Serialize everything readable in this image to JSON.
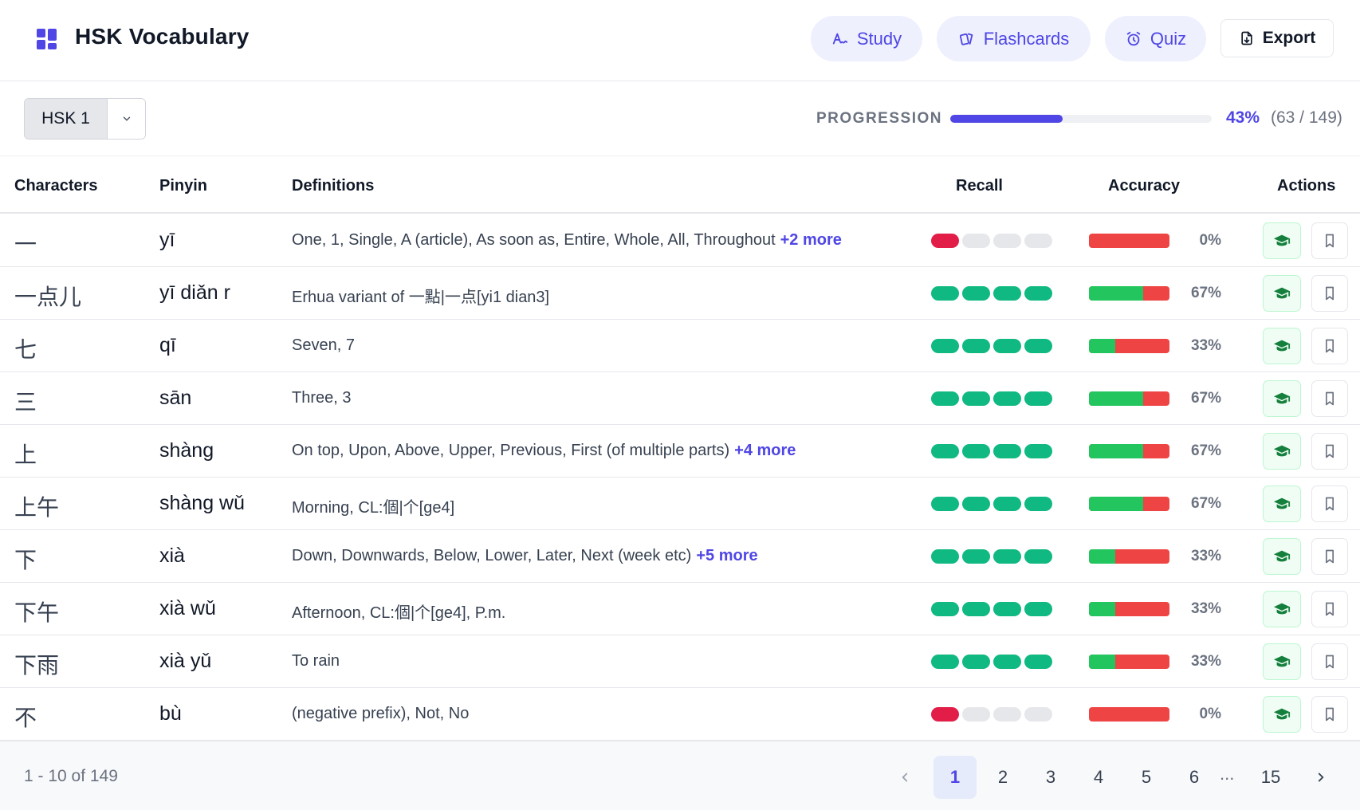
{
  "header": {
    "title": "HSK Vocabulary",
    "nav": {
      "study": "Study",
      "flashcards": "Flashcards",
      "quiz": "Quiz",
      "export": "Export"
    }
  },
  "toolbar": {
    "level": "HSK 1",
    "progress_label": "PROGRESSION",
    "progress_pct": "43%",
    "progress_count": "(63 / 149)",
    "progress_fraction": 0.43
  },
  "table": {
    "headers": {
      "characters": "Characters",
      "pinyin": "Pinyin",
      "definitions": "Definitions",
      "recall": "Recall",
      "accuracy": "Accuracy",
      "actions": "Actions"
    },
    "rows": [
      {
        "characters": "一",
        "pinyin": "yī",
        "definition": "One, 1, Single, A (article), As soon as, Entire, Whole, All, Throughout",
        "more": "+2 more",
        "recall": [
          "r",
          "e",
          "e",
          "e"
        ],
        "accuracy": 0,
        "accuracy_label": "0%"
      },
      {
        "characters": "一点儿",
        "pinyin": "yī diǎn r",
        "definition": "Erhua variant of 一點|一点[yi1 dian3]",
        "more": "",
        "recall": [
          "g",
          "g",
          "g",
          "g"
        ],
        "accuracy": 0.67,
        "accuracy_label": "67%"
      },
      {
        "characters": "七",
        "pinyin": "qī",
        "definition": "Seven, 7",
        "more": "",
        "recall": [
          "g",
          "g",
          "g",
          "g"
        ],
        "accuracy": 0.33,
        "accuracy_label": "33%"
      },
      {
        "characters": "三",
        "pinyin": "sān",
        "definition": "Three, 3",
        "more": "",
        "recall": [
          "g",
          "g",
          "g",
          "g"
        ],
        "accuracy": 0.67,
        "accuracy_label": "67%"
      },
      {
        "characters": "上",
        "pinyin": "shàng",
        "definition": "On top, Upon, Above, Upper, Previous, First (of multiple parts)",
        "more": "+4 more",
        "recall": [
          "g",
          "g",
          "g",
          "g"
        ],
        "accuracy": 0.67,
        "accuracy_label": "67%"
      },
      {
        "characters": "上午",
        "pinyin": "shàng wǔ",
        "definition": "Morning, CL:個|个[ge4]",
        "more": "",
        "recall": [
          "g",
          "g",
          "g",
          "g"
        ],
        "accuracy": 0.67,
        "accuracy_label": "67%"
      },
      {
        "characters": "下",
        "pinyin": "xià",
        "definition": "Down, Downwards, Below, Lower, Later, Next (week etc)",
        "more": "+5 more",
        "recall": [
          "g",
          "g",
          "g",
          "g"
        ],
        "accuracy": 0.33,
        "accuracy_label": "33%"
      },
      {
        "characters": "下午",
        "pinyin": "xià wǔ",
        "definition": "Afternoon, CL:個|个[ge4], P.m.",
        "more": "",
        "recall": [
          "g",
          "g",
          "g",
          "g"
        ],
        "accuracy": 0.33,
        "accuracy_label": "33%"
      },
      {
        "characters": "下雨",
        "pinyin": "xià yǔ",
        "definition": "To rain",
        "more": "",
        "recall": [
          "g",
          "g",
          "g",
          "g"
        ],
        "accuracy": 0.33,
        "accuracy_label": "33%"
      },
      {
        "characters": "不",
        "pinyin": "bù",
        "definition": "(negative prefix), Not, No",
        "more": "",
        "recall": [
          "r",
          "e",
          "e",
          "e"
        ],
        "accuracy": 0,
        "accuracy_label": "0%"
      }
    ]
  },
  "footer": {
    "count": "1 - 10 of 149",
    "pages": [
      "1",
      "2",
      "3",
      "4",
      "5",
      "6"
    ],
    "ellipsis": "...",
    "last_page": "15",
    "active_page": "1"
  },
  "colors": {
    "accent": "#4f46e5",
    "recall_good": "#10b981",
    "recall_bad": "#e11d48",
    "acc_good": "#22c55e",
    "acc_bad": "#ef4444"
  }
}
